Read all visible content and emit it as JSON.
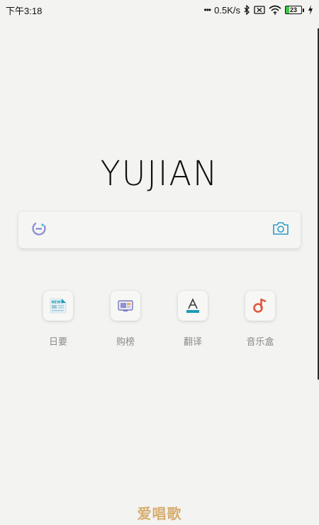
{
  "status_bar": {
    "time": "下午3:18",
    "dots": "•••",
    "network_speed": "0.5K/s",
    "battery_level": "23",
    "battery_fill_fraction": 0.23,
    "icons": [
      "bluetooth-icon",
      "sim-off-icon",
      "wifi-icon",
      "battery-icon",
      "charging-icon"
    ]
  },
  "app": {
    "logo_text": "YUJIAN"
  },
  "search": {
    "value": "",
    "placeholder": "",
    "left_icon": "browser-e-icon",
    "right_icon": "camera-icon"
  },
  "shortcuts": [
    {
      "label": "日要",
      "icon": "news-icon",
      "icon_text": "NEWS"
    },
    {
      "label": "购榜",
      "icon": "ranking-screen-icon"
    },
    {
      "label": "翻译",
      "icon": "translate-a-icon"
    },
    {
      "label": "音乐盒",
      "icon": "music-note-icon"
    }
  ],
  "watermark": "爱唱歌",
  "colors": {
    "background": "#f3f3f1",
    "accent_teal": "#1d9cb8",
    "music_red": "#e2553e",
    "watermark": "#d2a25a",
    "battery_green": "#3cc64a"
  }
}
